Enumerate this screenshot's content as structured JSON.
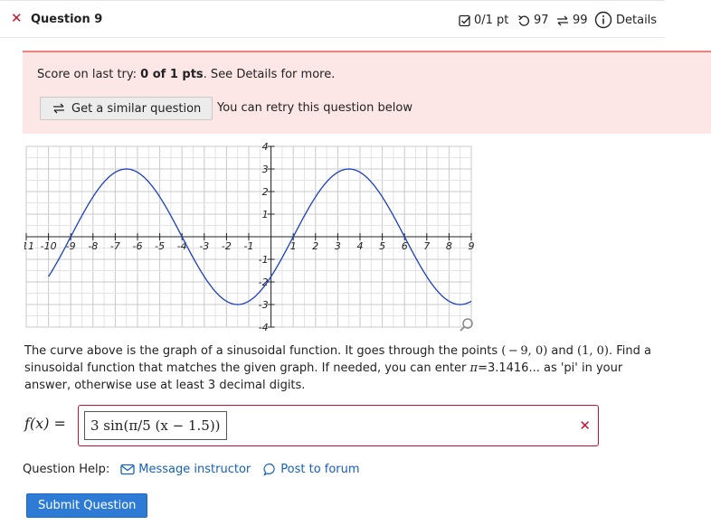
{
  "header": {
    "title": "Question 9",
    "score": "0/1 pt",
    "retries": "97",
    "attempts": "99",
    "details_label": "Details"
  },
  "score_box": {
    "prefix": "Score on last try: ",
    "score_value": "0 of 1 pts",
    "suffix": ". See Details for more.",
    "similar_button": "Get a similar question",
    "retry_text": "You can retry this question below"
  },
  "chart_data": {
    "type": "line",
    "x_ticks": [
      "-11",
      "-10",
      "-9",
      "-8",
      "-7",
      "-6",
      "-5",
      "-4",
      "-3",
      "-2",
      "-1",
      "1",
      "2",
      "3",
      "4",
      "5",
      "6",
      "7",
      "8",
      "9"
    ],
    "y_ticks": [
      "4",
      "3",
      "2",
      "1",
      "-1",
      "-2",
      "-3",
      "-4"
    ],
    "xlim": [
      -11,
      9
    ],
    "ylim": [
      -4,
      4
    ],
    "function": "3*sin(pi/5*(x-1))",
    "amplitude": 3,
    "period": 10,
    "x_zero_points": [
      -9,
      1
    ],
    "grid": true
  },
  "question": {
    "text_before": "The curve above is the graph of a sinusoidal function. It goes through the points ",
    "point1": "( − 9, 0)",
    "text_and": " and ",
    "point2": "(1, 0)",
    "text_after": ". Find a sinusoidal function that matches the given graph. If needed, you can enter ",
    "pi_symbol": "π",
    "pi_text": "=3.1416... as 'pi' in your answer, otherwise use at least 3 decimal digits."
  },
  "answer": {
    "label": "f(x) =",
    "value": "3 sin(π/5 (x − 1.5))",
    "status": "incorrect"
  },
  "help": {
    "label": "Question Help:",
    "message_link": "Message instructor",
    "forum_link": "Post to forum"
  },
  "submit_label": "Submit Question",
  "colors": {
    "incorrect": "#c8102e",
    "link": "#1560bd",
    "submit": "#2e7bd6",
    "score_bg": "#fde6e6",
    "curve": "#1a3fbf"
  }
}
